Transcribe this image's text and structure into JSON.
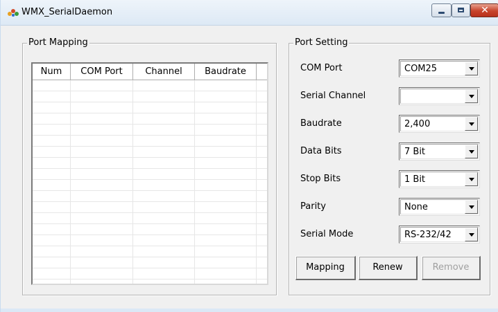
{
  "window": {
    "title": "WMX_SerialDaemon"
  },
  "port_mapping": {
    "title": "Port Mapping",
    "columns": [
      "Num",
      "COM Port",
      "Channel",
      "Baudrate"
    ],
    "rows": []
  },
  "port_setting": {
    "title": "Port Setting",
    "fields": [
      {
        "label": "COM Port",
        "value": "COM25"
      },
      {
        "label": "Serial Channel",
        "value": ""
      },
      {
        "label": "Baudrate",
        "value": "2,400"
      },
      {
        "label": "Data Bits",
        "value": "7 Bit"
      },
      {
        "label": "Stop Bits",
        "value": "1 Bit"
      },
      {
        "label": "Parity",
        "value": "None"
      },
      {
        "label": "Serial Mode",
        "value": "RS-232/42"
      }
    ],
    "buttons": [
      {
        "label": "Mapping",
        "enabled": true
      },
      {
        "label": "Renew",
        "enabled": true
      },
      {
        "label": "Remove",
        "enabled": false
      }
    ]
  },
  "icons": {
    "app": "app-logo-icon",
    "minimize": "minimize-icon",
    "maximize": "maximize-icon",
    "close": "close-icon",
    "dropdown": "chevron-down-icon"
  },
  "colors": {
    "close_button": "#c7432b",
    "window_bg": "#f0f0f0",
    "disabled_text": "#a0a0a0"
  }
}
